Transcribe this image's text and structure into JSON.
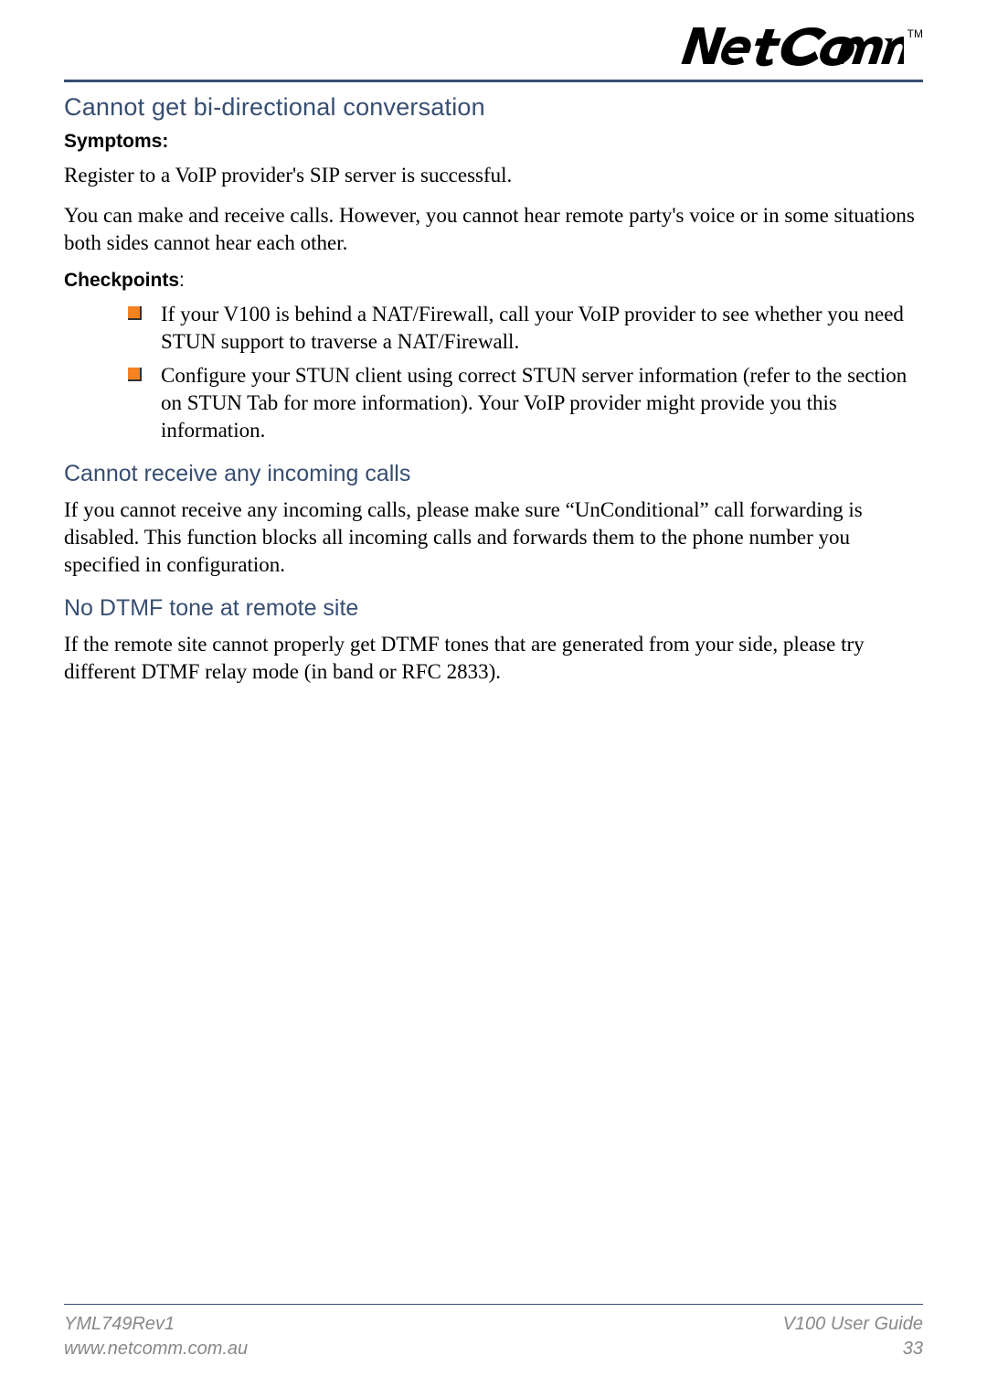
{
  "brand": {
    "name": "NetComm",
    "tm": "TM"
  },
  "sections": {
    "s1": {
      "heading": "Cannot get bi-directional conversation",
      "symptoms_label": "Symptoms:",
      "symptom1": "Register to a VoIP provider's SIP server is successful.",
      "symptom2": "You can make and receive calls. However, you cannot hear remote party's voice or in some situations both sides cannot hear each other.",
      "checkpoints_label": "Checkpoints",
      "checkpoints_colon": ":",
      "items": [
        "If your V100 is behind a NAT/Firewall, call your VoIP provider to see whether you need STUN support to traverse a NAT/Firewall.",
        "Configure your STUN client using correct STUN server information (refer to the section on STUN Tab for more information). Your VoIP provider might provide you this information."
      ]
    },
    "s2": {
      "heading": "Cannot receive any incoming calls",
      "body": "If you cannot receive any incoming calls, please make sure “UnConditional” call forwarding is disabled. This function blocks all incoming calls and forwards them to the phone number you specified in configuration."
    },
    "s3": {
      "heading": "No DTMF tone at remote site",
      "body": "If the remote site cannot properly get DTMF tones that are generated from your side, please try different DTMF relay mode (in band or RFC 2833)."
    }
  },
  "footer": {
    "left_line1": "YML749Rev1",
    "left_line2": "www.netcomm.com.au",
    "right_line1": "V100 User Guide",
    "right_line2": "33"
  }
}
